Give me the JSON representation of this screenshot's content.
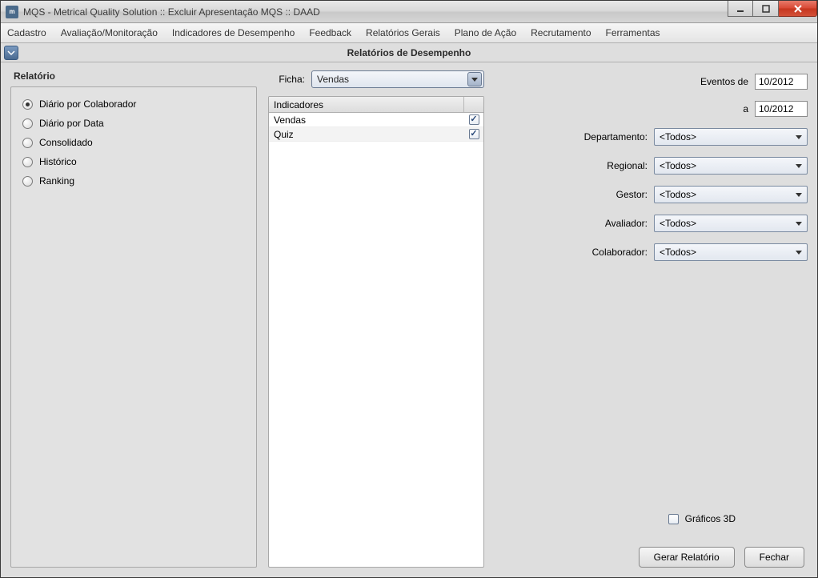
{
  "window": {
    "title": "MQS - Metrical Quality Solution :: Excluir Apresentação MQS :: DAAD"
  },
  "menubar": [
    "Cadastro",
    "Avaliação/Monitoração",
    "Indicadores de Desempenho",
    "Feedback",
    "Relatórios Gerais",
    "Plano de Ação",
    "Recrutamento",
    "Ferramentas"
  ],
  "page_title": "Relatórios de Desempenho",
  "relatorio": {
    "label": "Relatório",
    "options": [
      {
        "label": "Diário por Colaborador",
        "checked": true
      },
      {
        "label": "Diário por Data",
        "checked": false
      },
      {
        "label": "Consolidado",
        "checked": false
      },
      {
        "label": "Histórico",
        "checked": false
      },
      {
        "label": "Ranking",
        "checked": false
      }
    ]
  },
  "ficha": {
    "label": "Ficha:",
    "value": "Vendas"
  },
  "indicadores": {
    "header": "Indicadores",
    "rows": [
      {
        "label": "Vendas",
        "checked": true
      },
      {
        "label": "Quiz",
        "checked": true
      }
    ]
  },
  "eventos": {
    "de_label": "Eventos de",
    "de_value": "10/2012",
    "a_label": "a",
    "a_value": "10/2012"
  },
  "filters": {
    "departamento": {
      "label": "Departamento:",
      "value": "<Todos>"
    },
    "regional": {
      "label": "Regional:",
      "value": "<Todos>"
    },
    "gestor": {
      "label": "Gestor:",
      "value": "<Todos>"
    },
    "avaliador": {
      "label": "Avaliador:",
      "value": "<Todos>"
    },
    "colaborador": {
      "label": "Colaborador:",
      "value": "<Todos>"
    }
  },
  "graficos3d": {
    "label": "Gráficos 3D",
    "checked": false
  },
  "buttons": {
    "gerar": "Gerar Relatório",
    "fechar": "Fechar"
  }
}
